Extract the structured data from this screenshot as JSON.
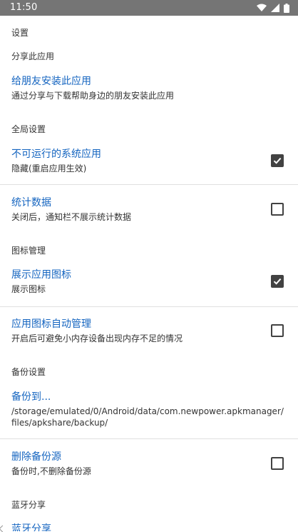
{
  "status_bar": {
    "time": "11:50",
    "icons": [
      "wifi-icon",
      "cellular-signal-icon",
      "battery-icon"
    ],
    "background": "#757575"
  },
  "colors": {
    "accent": "#1565c0",
    "text": "#333333",
    "checkbox": "#424242",
    "divider": "#e0e0e0"
  },
  "page_title": "设置",
  "sections": {
    "share": {
      "header": "分享此应用",
      "install_for_friends": {
        "title": "给朋友安装此应用",
        "summary": "通过分享与下载帮助身边的朋友安装此应用"
      }
    },
    "global": {
      "header": "全局设置",
      "system_apps": {
        "title": "不可运行的系统应用",
        "summary": "隐藏(重启应用生效)",
        "checked": true
      },
      "statistics": {
        "title": "统计数据",
        "summary": "关闭后，通知栏不展示统计数据",
        "checked": false
      }
    },
    "icon": {
      "header": "图标管理",
      "show_icon": {
        "title": "展示应用图标",
        "summary": "展示图标",
        "checked": true
      },
      "auto_manage": {
        "title": "应用图标自动管理",
        "summary": "开启后可避免小内存设备出现内存不足的情况",
        "checked": false
      }
    },
    "backup": {
      "header": "备份设置",
      "backup_to": {
        "title": "备份到...",
        "summary_line1": "/storage/emulated/0/Android/data/com.newpower.apkmanager/",
        "summary_line2": "files/apkshare/backup/"
      },
      "delete_source": {
        "title": "删除备份源",
        "summary": "备份时,不删除备份源",
        "checked": false
      }
    },
    "bluetooth": {
      "header": "蓝牙分享",
      "share": {
        "title": "蓝牙分享"
      }
    }
  }
}
